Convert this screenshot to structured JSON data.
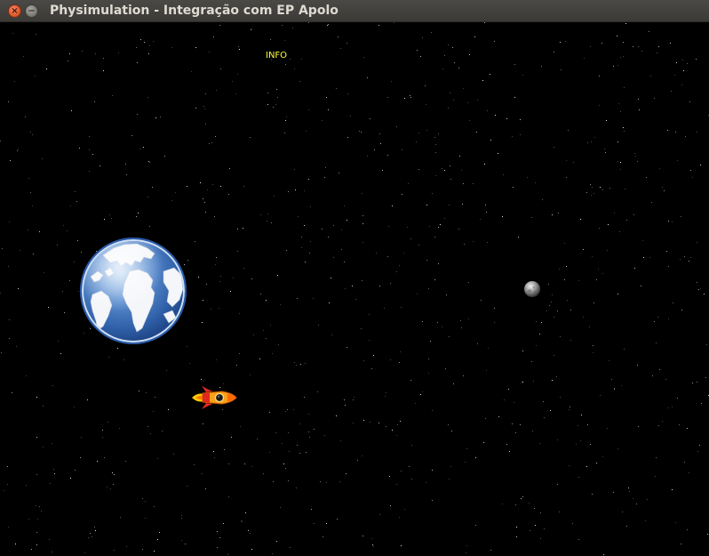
{
  "window": {
    "title": "Physimulation - Integração com EP Apolo",
    "close_glyph": "×",
    "minimize_glyph": "−"
  },
  "hud": {
    "info_label": "INFO"
  },
  "scene": {
    "background_color": "#000000",
    "info_color": "#ffff33",
    "objects": [
      "earth",
      "moon",
      "rocket"
    ]
  }
}
